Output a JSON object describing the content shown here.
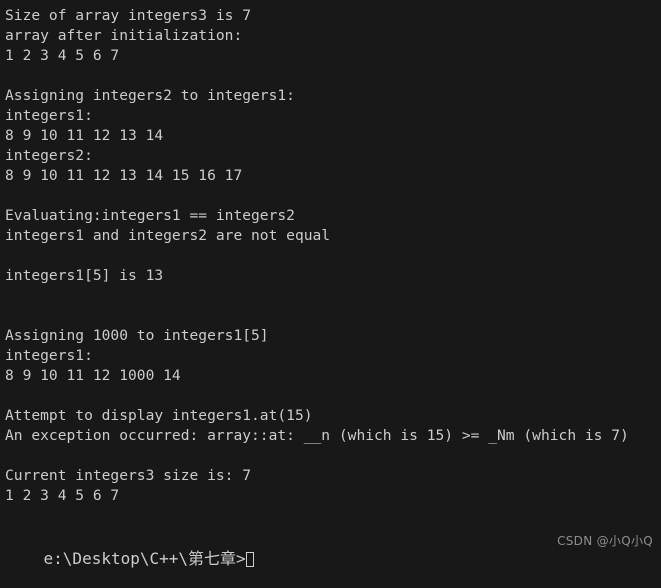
{
  "terminal": {
    "background_color": "#181818",
    "foreground_color": "#cccccc",
    "cursor_color": "#cfcfcf",
    "lines": [
      "Size of array integers3 is 7",
      "array after initialization:",
      "1 2 3 4 5 6 7",
      "",
      "Assigning integers2 to integers1:",
      "integers1:",
      "8 9 10 11 12 13 14",
      "integers2:",
      "8 9 10 11 12 13 14 15 16 17",
      "",
      "Evaluating:integers1 == integers2",
      "integers1 and integers2 are not equal",
      "",
      "integers1[5] is 13",
      "",
      "",
      "Assigning 1000 to integers1[5]",
      "integers1:",
      "8 9 10 11 12 1000 14",
      "",
      "Attempt to display integers1.at(15)",
      "An exception occurred: array::at: __n (which is 15) >= _Nm (which is 7)",
      "",
      "Current integers3 size is: 7",
      "1 2 3 4 5 6 7",
      ""
    ],
    "prompt": "e:\\Desktop\\C++\\第七章>",
    "cursor": "block-outline"
  },
  "watermark": {
    "text": "CSDN @小Q小Q",
    "color": "#8e8e8e"
  }
}
